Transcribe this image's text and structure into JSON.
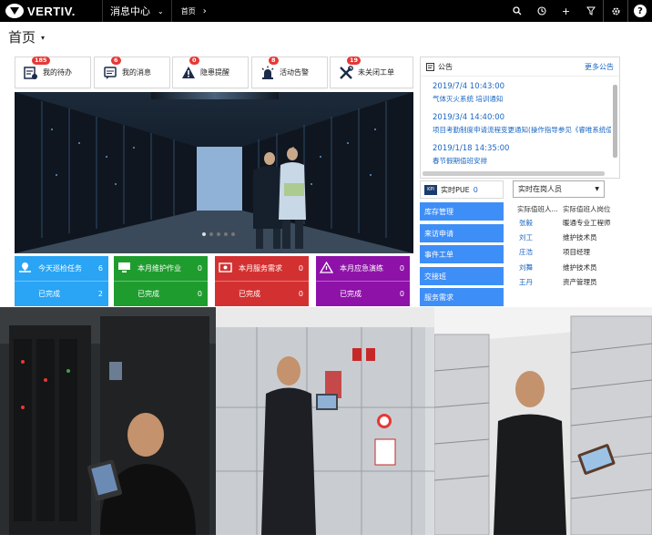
{
  "header": {
    "brand": "VERTIV.",
    "module": "消息中心",
    "breadcrumb": "首页",
    "icons": [
      "search-icon",
      "history-icon",
      "plus-icon",
      "filter-icon",
      "gear-icon",
      "help-icon"
    ]
  },
  "page": {
    "title": "首页"
  },
  "quick_links": [
    {
      "label": "我的待办",
      "badge": "185",
      "icon": "todo-icon"
    },
    {
      "label": "我的消息",
      "badge": "6",
      "icon": "message-icon"
    },
    {
      "label": "隐患提醒",
      "badge": "0",
      "icon": "warning-icon"
    },
    {
      "label": "活动告警",
      "badge": "8",
      "icon": "alarm-icon"
    },
    {
      "label": "未关闭工单",
      "badge": "19",
      "icon": "tools-icon"
    }
  ],
  "stats": [
    {
      "title": "今天巡检任务",
      "count": "6",
      "done_label": "已完成",
      "done": "2",
      "color": "#2aa4f4"
    },
    {
      "title": "本月维护作业",
      "count": "0",
      "done_label": "已完成",
      "done": "0",
      "color": "#1f9c2e"
    },
    {
      "title": "本月服务需求",
      "count": "0",
      "done_label": "已完成",
      "done": "0",
      "color": "#d33131"
    },
    {
      "title": "本月应急演练",
      "count": "0",
      "done_label": "已完成",
      "done": "0",
      "color": "#8e12a8"
    }
  ],
  "notice": {
    "title": "公告",
    "more": "更多公告",
    "items": [
      {
        "date": "2019/7/4 10:43:00",
        "subject": "气体灭火系统 培训通知"
      },
      {
        "date": "2019/3/4 14:40:00",
        "subject": "项目考勤制度申请流程变更通知(操作指导参见《睿唯系统值班"
      },
      {
        "date": "2019/1/18 14:35:00",
        "subject": "春节假期值班安排"
      }
    ]
  },
  "pue": {
    "label": "实时PUE",
    "value": "0"
  },
  "side_menu": [
    "库存管理",
    "来访申请",
    "事件工单",
    "交接班",
    "服务需求"
  ],
  "staff": {
    "select_label": "实时在岗人员",
    "col_name": "实际值班人...",
    "col_post": "实际值班人岗位",
    "rows": [
      {
        "name": "张毅",
        "post": "暖通专业工程师"
      },
      {
        "name": "刘工",
        "post": "维护技术员"
      },
      {
        "name": "庄浩",
        "post": "项目经理"
      },
      {
        "name": "刘舞",
        "post": "维护技术员"
      },
      {
        "name": "王丹",
        "post": "资产管理员"
      }
    ]
  },
  "colors": {
    "topbar": "#000000",
    "link": "#1a66c2",
    "menu": "#3e8ef7",
    "badge": "#e53935"
  }
}
